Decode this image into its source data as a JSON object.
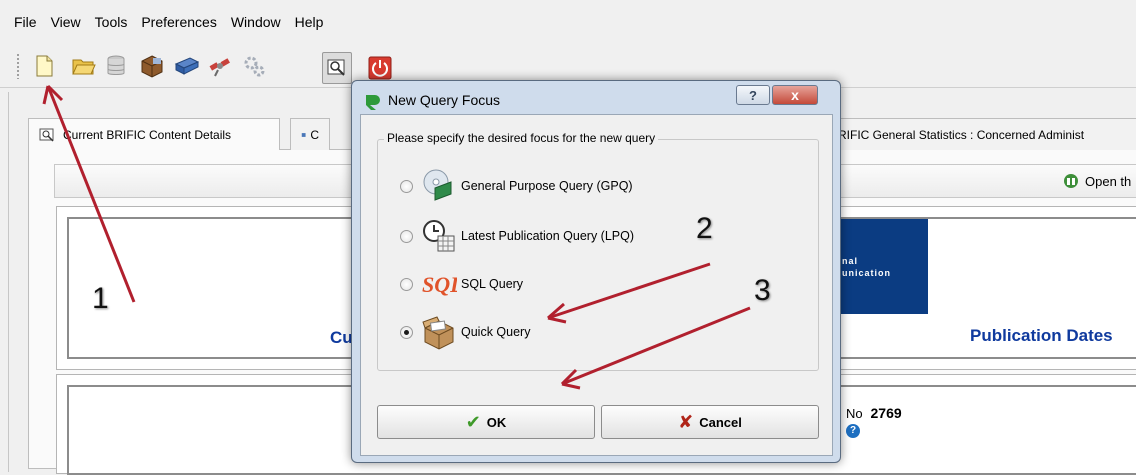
{
  "menu": [
    "File",
    "View",
    "Tools",
    "Preferences",
    "Window",
    "Help"
  ],
  "toolbar_icons": [
    "new-document-icon",
    "open-folder-icon",
    "database-icon",
    "package-icon",
    "printer-icon",
    "satellite-icon",
    "gears-icon",
    "query-monitor-icon",
    "power-icon"
  ],
  "tabs": {
    "first": "Current BRIFIC Content Details",
    "second": "C",
    "third": "RIFIC General Statistics : Concerned Administ"
  },
  "open_button": "Open th",
  "logo_lines": [
    "nal",
    "unication"
  ],
  "content": {
    "cu": "Cu",
    "publication_dates": "Publication Dates",
    "no_label": "No",
    "no_value": "2769"
  },
  "dialog": {
    "title": "New Query Focus",
    "help_button": "?",
    "close_button": "x",
    "group_title": "Please specify the desired focus for the new query",
    "options": [
      {
        "label": "General Purpose Query (GPQ)",
        "icon": "cd-book-icon",
        "selected": false
      },
      {
        "label": "Latest Publication Query (LPQ)",
        "icon": "clock-calendar-icon",
        "selected": false
      },
      {
        "label": "SQL Query",
        "icon": "sql-icon",
        "selected": false
      },
      {
        "label": "Quick Query",
        "icon": "open-box-icon",
        "selected": true
      }
    ],
    "ok_label": "OK",
    "cancel_label": "Cancel"
  },
  "annotations": {
    "one": "1",
    "two": "2",
    "three": "3",
    "arrow_color": "#b1202e"
  }
}
